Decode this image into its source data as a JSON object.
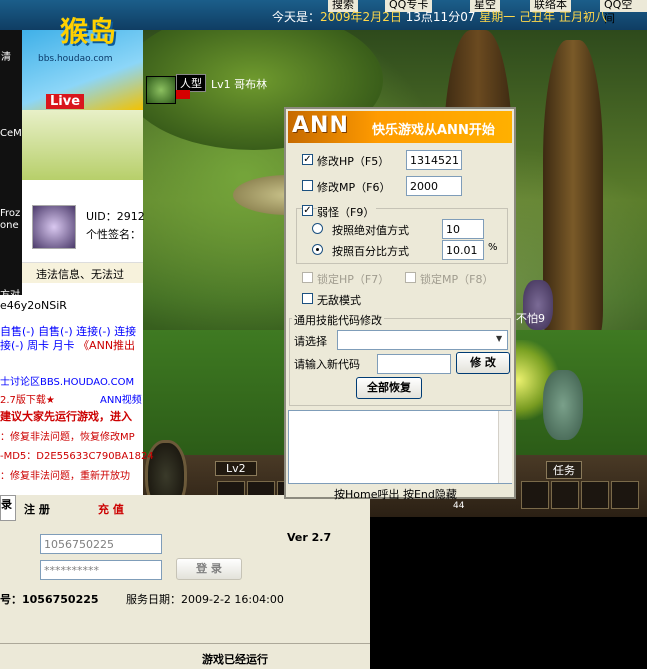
{
  "topbar": {
    "date_prefix": "今天是：",
    "date_year": "2009年2月2日",
    "date_time": "13点11分07",
    "date_weekday": "星期一",
    "date_lunar": "己丑年 正月初八",
    "menu": [
      "搜索",
      "QQ专卡",
      "星空",
      "联络本",
      "QQ空间"
    ]
  },
  "browser": {
    "logo_cn": "猴岛",
    "logo_url": "bbs.houdao.com",
    "logo_live": "Live",
    "side_labels": [
      "清",
      "CeM",
      "Froz",
      "one",
      "方对"
    ],
    "uid_label": "UID：2912",
    "signature_label": "个性签名：",
    "notice": "违法信息、无法过",
    "token": "e46y2oNSiR",
    "links_row1": [
      "自售(-)",
      "自售(-)",
      "连接(-)",
      "连接"
    ],
    "links_row2": [
      "接(-)",
      "周卡",
      "月卡",
      "《ANN推出"
    ],
    "forum_link": "士讨论区BBS.HOUDAO.COM",
    "news": [
      "2.7版下载★",
      "ANN视频",
      "建议大家先运行游戏，进入",
      "：修复非法问题，恢复修改MP",
      "-MD5：D2E55633C790BA1824",
      "：修复非法问题，重新开放功"
    ]
  },
  "game": {
    "player_type": "人型",
    "player_level": "Lv1 哥布林",
    "enemy_label": "不怕9",
    "hud_level": "Lv2",
    "task_label": "任务",
    "slot_count": "44"
  },
  "ann": {
    "logo": "ANN",
    "slogan": "快乐游戏从ANN开始",
    "hp_label": "修改HP（F5）",
    "hp_value": "1314521",
    "mp_label": "修改MP（F6）",
    "mp_value": "2000",
    "weak_label": "弱怪（F9）",
    "abs_label": "按照绝对值方式",
    "abs_value": "10",
    "pct_label": "按照百分比方式",
    "pct_value": "10.01",
    "pct_unit": "%",
    "lock_hp": "锁定HP（F7）",
    "lock_mp": "锁定MP（F8）",
    "god_label": "无敌模式",
    "skill_group": "通用技能代码修改",
    "select_label": "请选择",
    "newcode_label": "请输入新代码",
    "modify_btn": "修 改",
    "restore_btn": "全部恢复",
    "footer": "按Home呼出 按End隐藏"
  },
  "login": {
    "tab_login": "录",
    "tab_register": "注 册",
    "tab_recharge": "充 值",
    "account_value": "1056750225",
    "password_value": "**********",
    "login_btn": "登 录",
    "version": "Ver 2.7",
    "account_info": "号：1056750225",
    "service_date": "服务日期：2009-2-2 16:04:00",
    "status": "游戏已经运行"
  }
}
